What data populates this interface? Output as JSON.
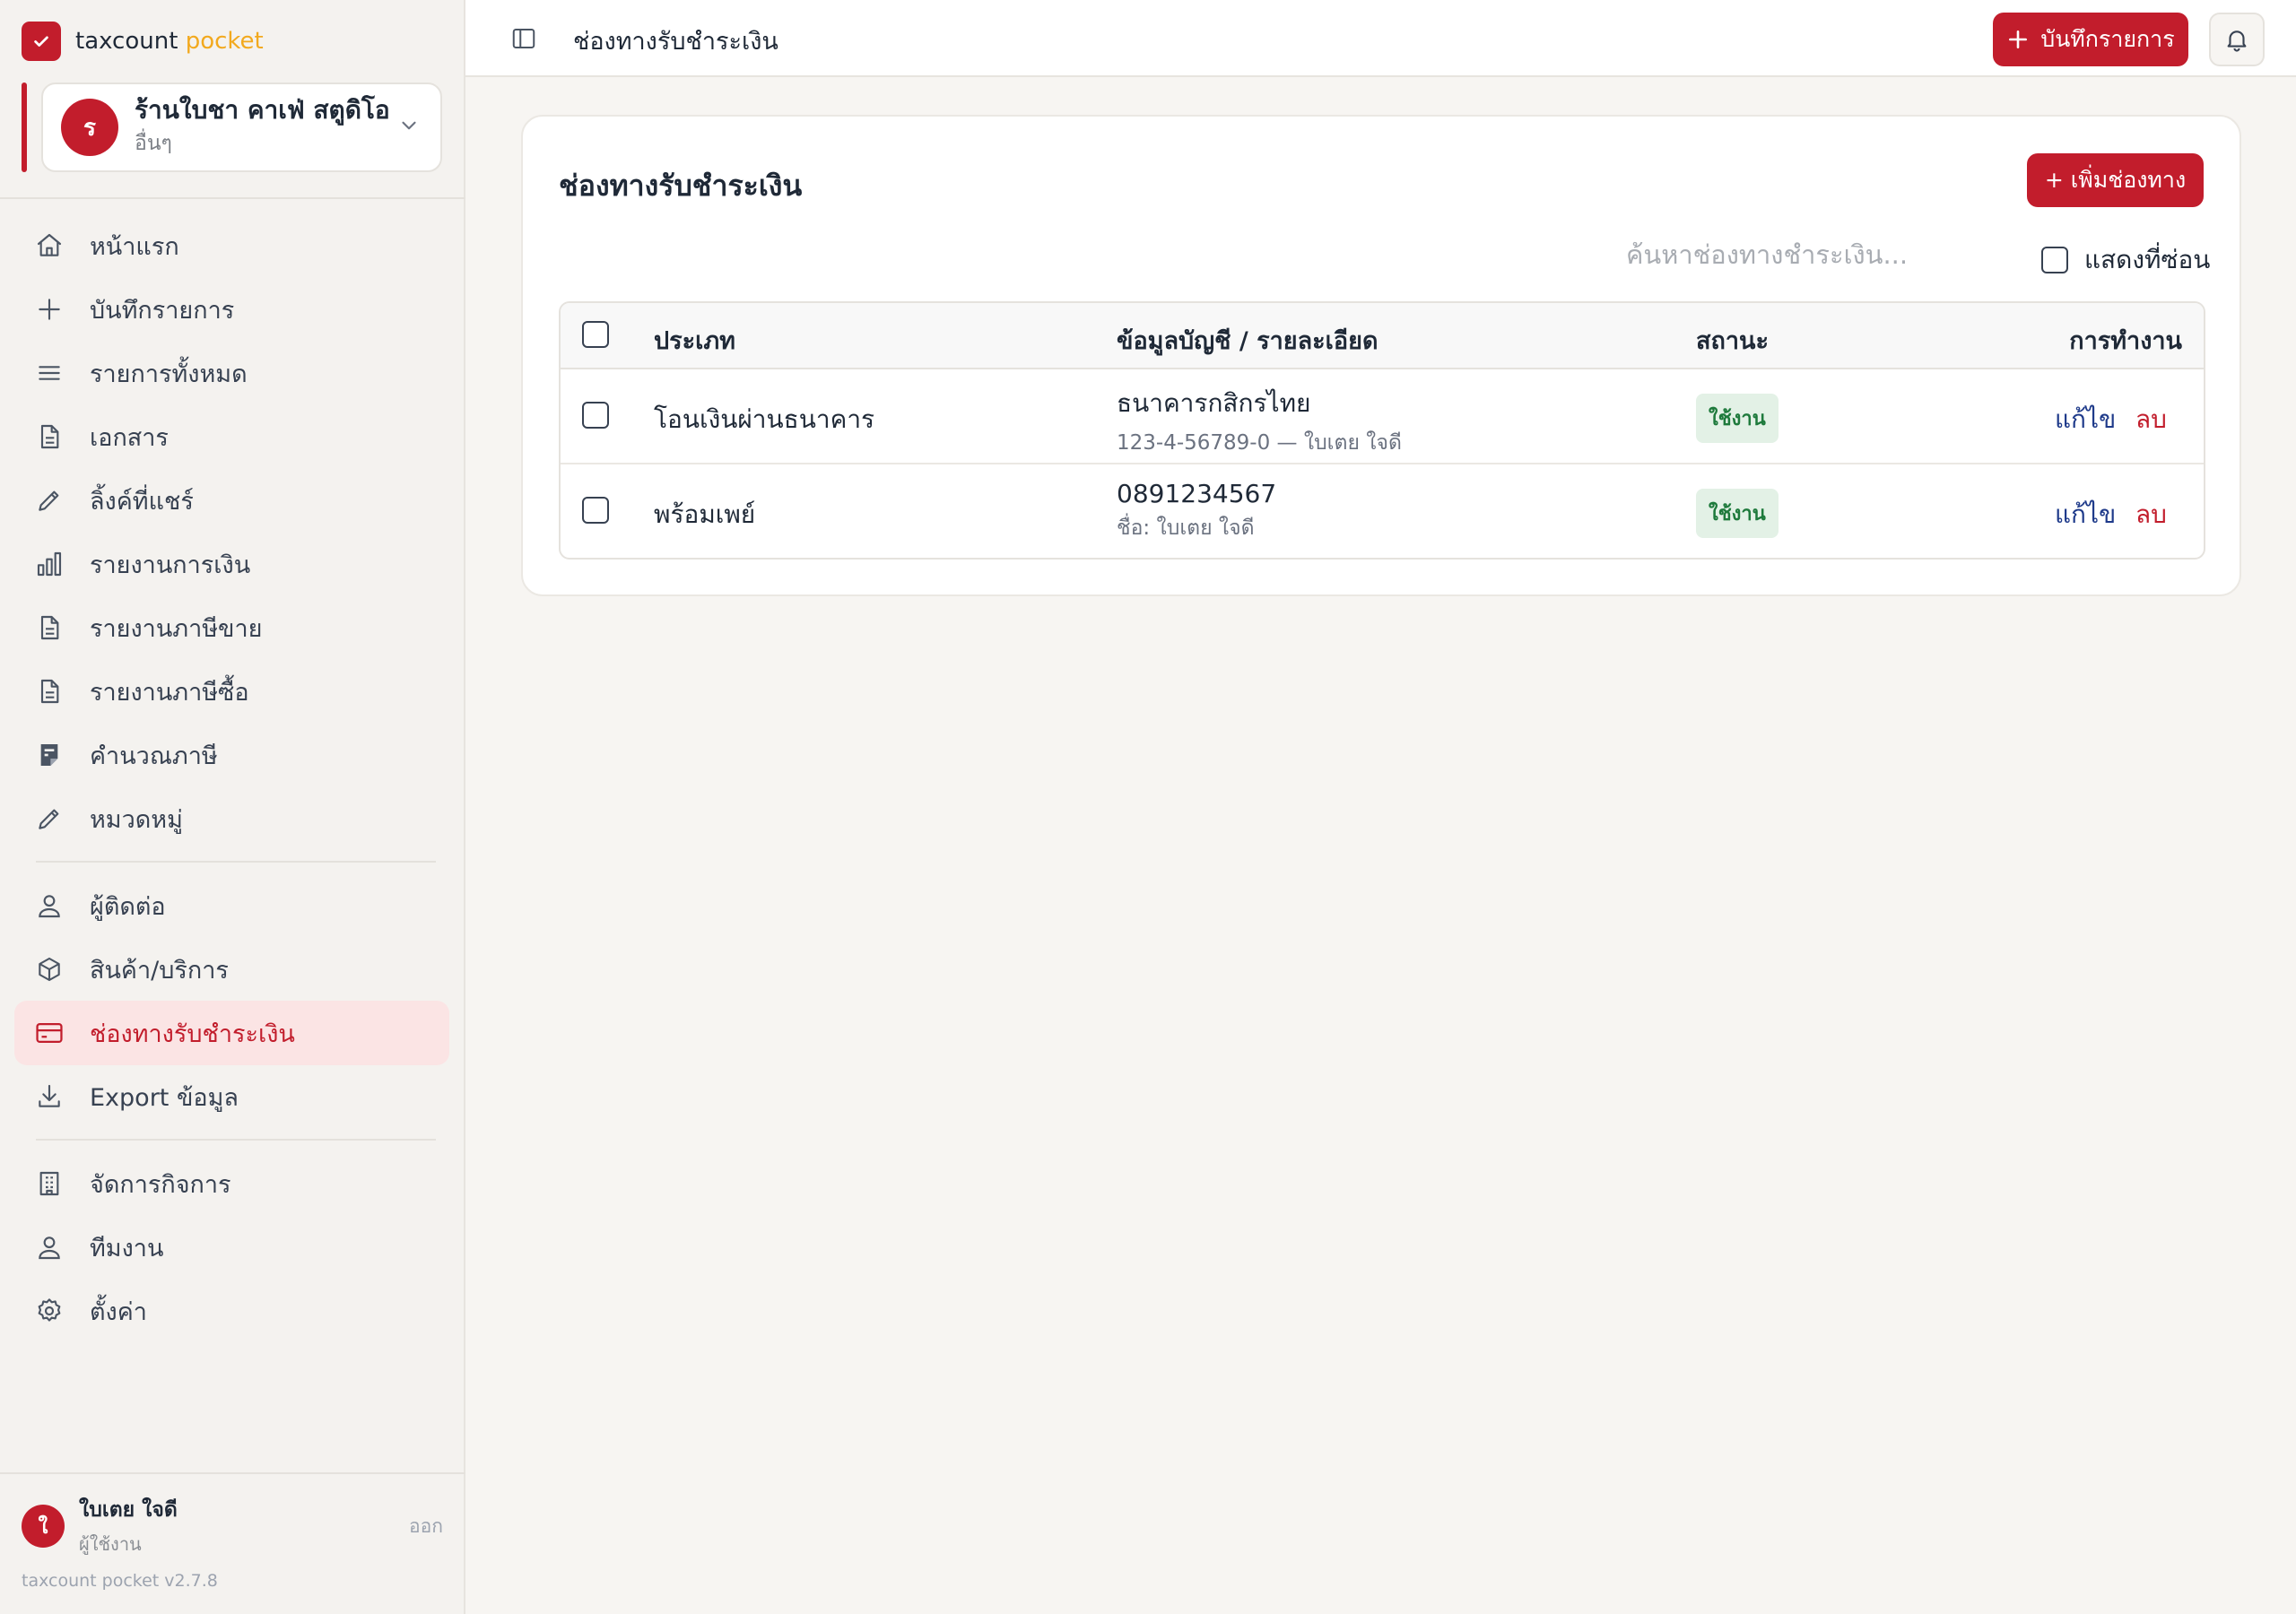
{
  "brand": {
    "name": "taxcount",
    "accent": "pocket",
    "color": "#c21d2c",
    "accent_color": "#f2a91e"
  },
  "workspace": {
    "avatar": "ร",
    "name": "ร้านใบชา คาเฟ่ สตูดิโอ",
    "type": "อื่นๆ"
  },
  "nav": {
    "home": "หน้าแรก",
    "record": "บันทึกรายการ",
    "all_transactions": "รายการทั้งหมด",
    "documents": "เอกสาร",
    "shared_links": "ลิ้งค์ที่แชร์",
    "financial_report": "รายงานการเงิน",
    "sales_tax_report": "รายงานภาษีขาย",
    "purchase_tax_report": "รายงานภาษีซื้อ",
    "tax_calc": "คำนวณภาษี",
    "categories": "หมวดหมู่",
    "contacts": "ผู้ติดต่อ",
    "products": "สินค้า/บริการ",
    "payment_channels": "ช่องทางรับชำระเงิน",
    "export": "Export ข้อมูล",
    "business": "จัดการกิจการ",
    "team": "ทีมงาน",
    "settings": "ตั้งค่า"
  },
  "user": {
    "avatar": "ใ",
    "name": "ใบเตย ใจดี",
    "role": "ผู้ใช้งาน",
    "logout": "ออก"
  },
  "version": "taxcount pocket v2.7.8",
  "topbar": {
    "title": "ช่องทางรับชำระเงิน",
    "record_button": "บันทึกรายการ"
  },
  "page": {
    "title": "ช่องทางรับชำระเงิน",
    "add_button": "+ เพิ่มช่องทาง",
    "search_placeholder": "ค้นหาช่องทางชำระเงิน...",
    "show_hidden_label": "แสดงที่ซ่อน"
  },
  "table": {
    "headers": {
      "type": "ประเภท",
      "details": "ข้อมูลบัญชี / รายละเอียด",
      "status": "สถานะ",
      "actions": "การทำงาน"
    },
    "rows": [
      {
        "type": "โอนเงินผ่านธนาคาร",
        "main": "ธนาคารกสิกรไทย",
        "sub": "123-4-56789-0 — ใบเตย ใจดี",
        "status": "ใช้งาน",
        "edit": "แก้ไข",
        "delete": "ลบ"
      },
      {
        "type": "พร้อมเพย์",
        "main": "0891234567",
        "sub": "ชื่อ: ใบเตย ใจดี",
        "status": "ใช้งาน",
        "edit": "แก้ไข",
        "delete": "ลบ"
      }
    ]
  }
}
